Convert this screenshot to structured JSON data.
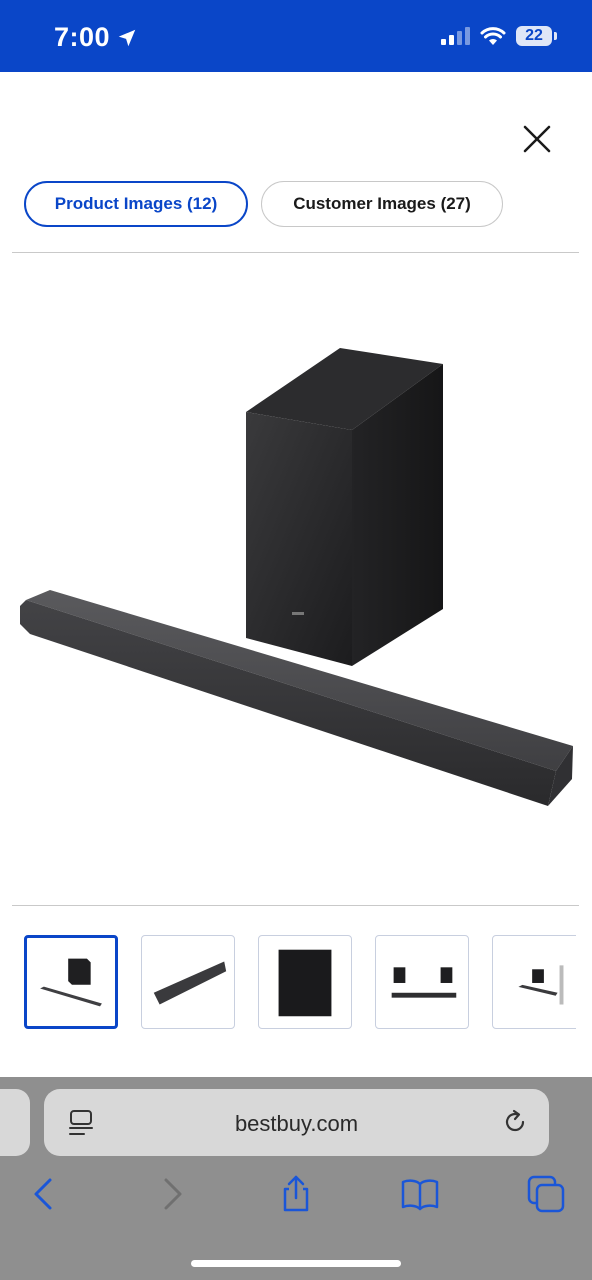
{
  "status_bar": {
    "time": "7:00",
    "battery": "22",
    "icons": [
      "location-arrow-icon",
      "signal-icon",
      "wifi-icon",
      "battery-icon"
    ]
  },
  "modal": {
    "close_icon": "close-icon",
    "tabs": [
      {
        "label": "Product Images (12)",
        "active": true
      },
      {
        "label": "Customer Images (27)",
        "active": false
      }
    ]
  },
  "gallery": {
    "main_image": "soundbar-with-subwoofer",
    "thumbnails": [
      {
        "name": "soundbar-and-subwoofer",
        "selected": true
      },
      {
        "name": "soundbar-angle",
        "selected": false
      },
      {
        "name": "subwoofer-front",
        "selected": false
      },
      {
        "name": "components-layout",
        "selected": false
      },
      {
        "name": "product-detail-sheet",
        "selected": false
      }
    ]
  },
  "browser": {
    "url": "bestbuy.com",
    "toolbar": [
      "back-icon",
      "forward-icon",
      "share-icon",
      "bookmarks-icon",
      "tabs-icon"
    ]
  },
  "colors": {
    "brand_blue": "#0a46c8",
    "browser_bg": "#8f8f8f",
    "url_bar_bg": "#d8d8d8"
  }
}
